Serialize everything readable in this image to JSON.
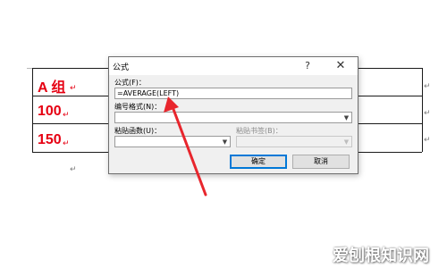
{
  "document": {
    "rows": [
      {
        "text": "A 组"
      },
      {
        "text": "100"
      },
      {
        "text": "150"
      }
    ]
  },
  "dialog": {
    "title": "公式",
    "help_label": "?",
    "close_label": "✕",
    "formula_label": "公式(F)：",
    "formula_value": "=AVERAGE(LEFT)",
    "number_format_label": "编号格式(N)：",
    "number_format_value": "",
    "paste_function_label": "粘贴函数(U)：",
    "paste_function_value": "",
    "paste_bookmark_label": "粘贴书签(B)：",
    "paste_bookmark_value": "",
    "ok_label": "确定",
    "cancel_label": "取消"
  },
  "annotation": {
    "arrow_color": "#e8262d"
  },
  "watermark": {
    "text": "爱刨根知识网"
  }
}
